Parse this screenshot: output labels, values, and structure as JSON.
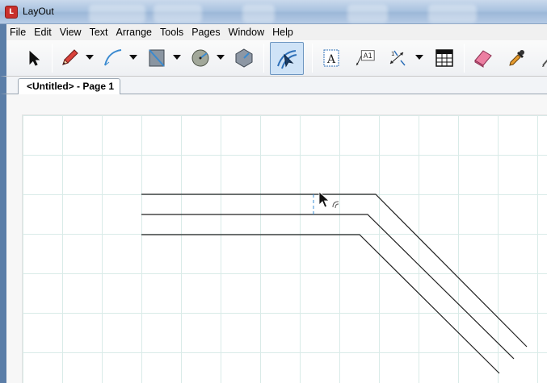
{
  "window": {
    "title": "LayOut",
    "icon_glyph": "L"
  },
  "menu": {
    "items": [
      "File",
      "Edit",
      "View",
      "Text",
      "Arrange",
      "Tools",
      "Pages",
      "Window",
      "Help"
    ]
  },
  "toolbar": {
    "tools": [
      {
        "name": "select-tool",
        "icon": "arrow-cursor-icon"
      },
      {
        "name": "line-tool",
        "icon": "pencil-icon",
        "dropdown": true
      },
      {
        "name": "arc-tool",
        "icon": "arc-icon",
        "dropdown": true
      },
      {
        "name": "rectangle-tool",
        "icon": "rectangle-icon",
        "dropdown": true
      },
      {
        "name": "circle-tool",
        "icon": "circle-icon",
        "dropdown": true
      },
      {
        "name": "polygon-tool",
        "icon": "polygon-icon"
      },
      {
        "name": "offset-tool",
        "icon": "offset-icon",
        "active": true
      },
      {
        "name": "text-tool",
        "icon": "text-icon"
      },
      {
        "name": "label-tool",
        "icon": "label-icon"
      },
      {
        "name": "dimension-tool",
        "icon": "dimension-icon",
        "dropdown": true
      },
      {
        "name": "table-tool",
        "icon": "table-icon"
      },
      {
        "name": "eraser-tool",
        "icon": "eraser-icon"
      },
      {
        "name": "style-tool",
        "icon": "eyedropper-icon"
      },
      {
        "name": "split-tool",
        "icon": "split-icon"
      }
    ]
  },
  "document_tab": {
    "label": "<Untitled> - Page 1"
  },
  "colors": {
    "accent": "#5b7ea8",
    "grid": "#d9ebe8",
    "stroke": "#222222",
    "guide": "#3b8fd6"
  }
}
